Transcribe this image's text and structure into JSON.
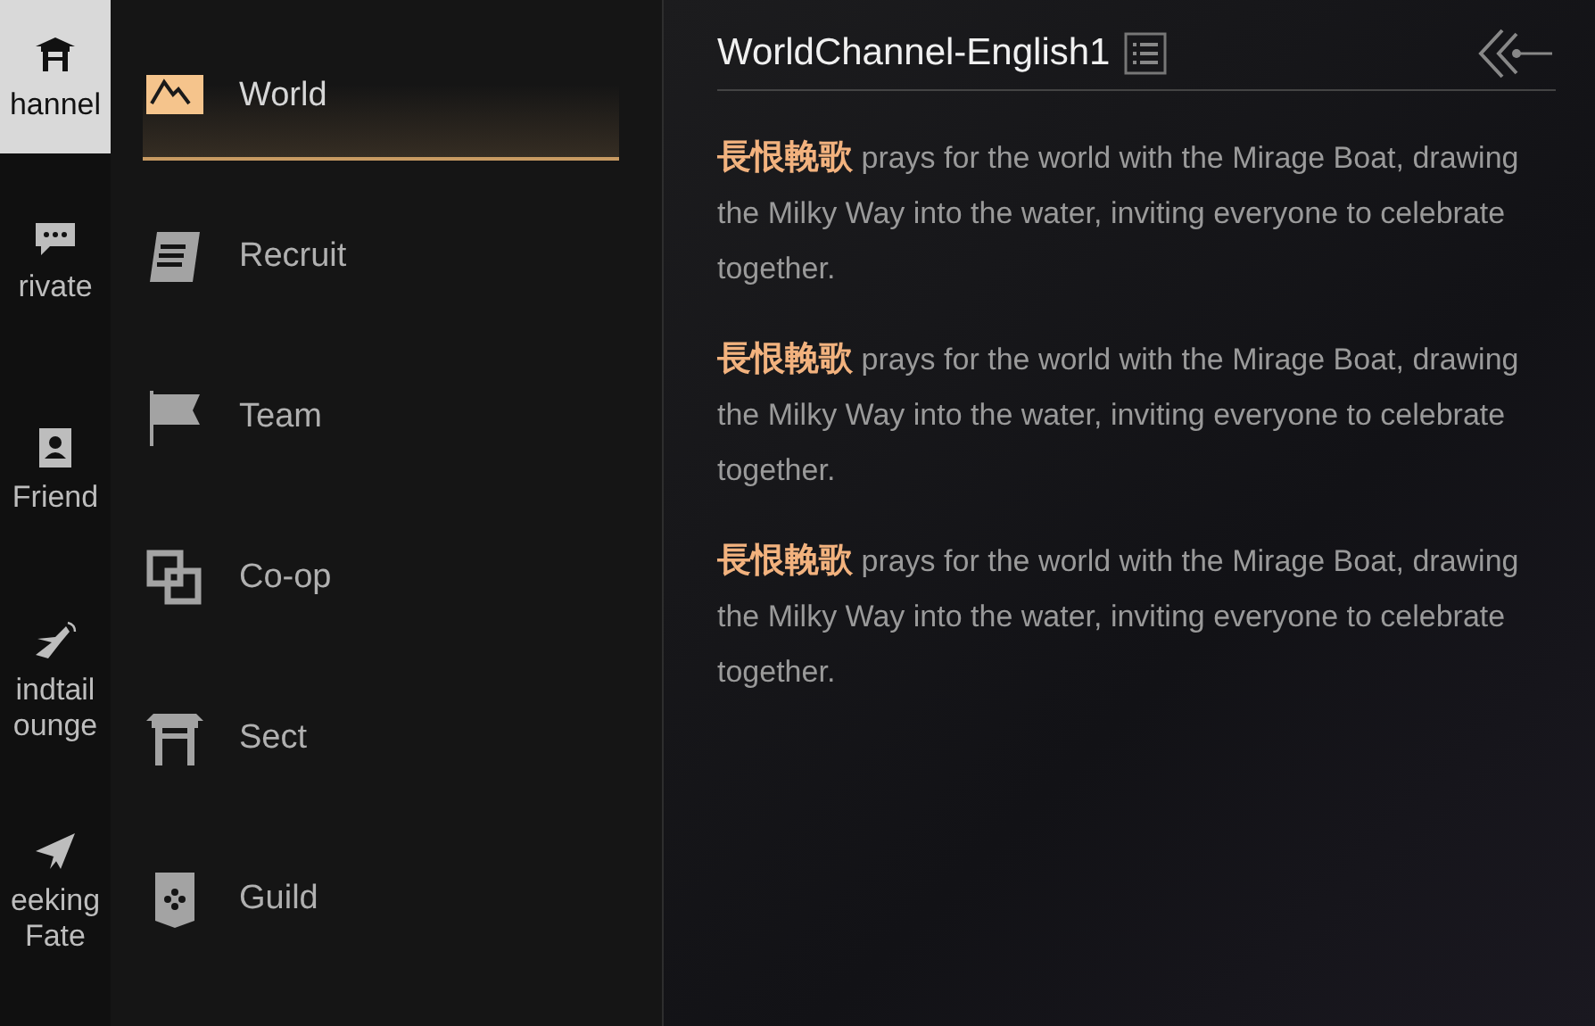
{
  "side_tabs": [
    {
      "kind": "channel",
      "lines": [
        "hannel"
      ],
      "selected": true
    },
    {
      "kind": "private",
      "lines": [
        "rivate"
      ],
      "selected": false
    },
    {
      "kind": "friend",
      "lines": [
        "Friend"
      ],
      "selected": false
    },
    {
      "kind": "windtail",
      "lines": [
        "indtail",
        "ounge"
      ],
      "selected": false
    },
    {
      "kind": "fate",
      "lines": [
        "eeking",
        "Fate"
      ],
      "selected": false
    }
  ],
  "channels": [
    {
      "kind": "world",
      "label": "World",
      "selected": true
    },
    {
      "kind": "recruit",
      "label": "Recruit",
      "selected": false
    },
    {
      "kind": "team",
      "label": "Team",
      "selected": false
    },
    {
      "kind": "coop",
      "label": "Co-op",
      "selected": false
    },
    {
      "kind": "sect",
      "label": "Sect",
      "selected": false
    },
    {
      "kind": "guild",
      "label": "Guild",
      "selected": false
    }
  ],
  "chat": {
    "title": "WorldChannel-English1",
    "messages": [
      {
        "sender": "長恨輓歌",
        "text": "prays for the world with the Mirage Boat, drawing the Milky Way into the water, inviting everyone to celebrate together."
      },
      {
        "sender": "長恨輓歌",
        "text": "prays for the world with the Mirage Boat, drawing the Milky Way into the water, inviting everyone to celebrate together."
      },
      {
        "sender": "長恨輓歌",
        "text": "prays for the world with the Mirage Boat, drawing the Milky Way into the water, inviting everyone to celebrate together."
      }
    ]
  }
}
